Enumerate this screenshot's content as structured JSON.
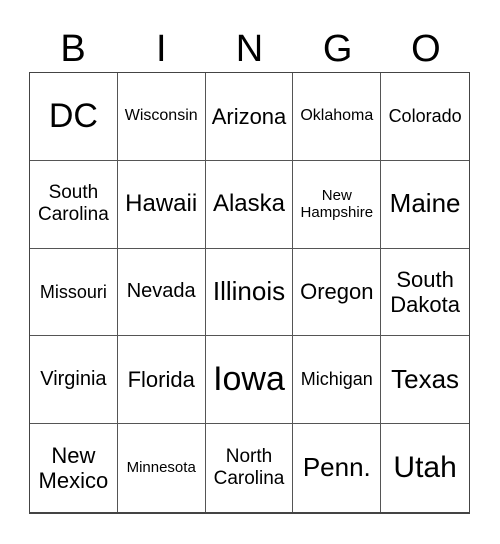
{
  "header": {
    "letters": [
      "B",
      "I",
      "N",
      "G",
      "O"
    ]
  },
  "board": {
    "rows": [
      [
        "DC",
        "Wisconsin",
        "Arizona",
        "Oklahoma",
        "Colorado"
      ],
      [
        "South\nCarolina",
        "Hawaii",
        "Alaska",
        "New\nHampshire",
        "Maine"
      ],
      [
        "Missouri",
        "Nevada",
        "Illinois",
        "Oregon",
        "South\nDakota"
      ],
      [
        "Virginia",
        "Florida",
        "Iowa",
        "Michigan",
        "Texas"
      ],
      [
        "New\nMexico",
        "Minnesota",
        "North\nCarolina",
        "Penn.",
        "Utah"
      ]
    ]
  }
}
